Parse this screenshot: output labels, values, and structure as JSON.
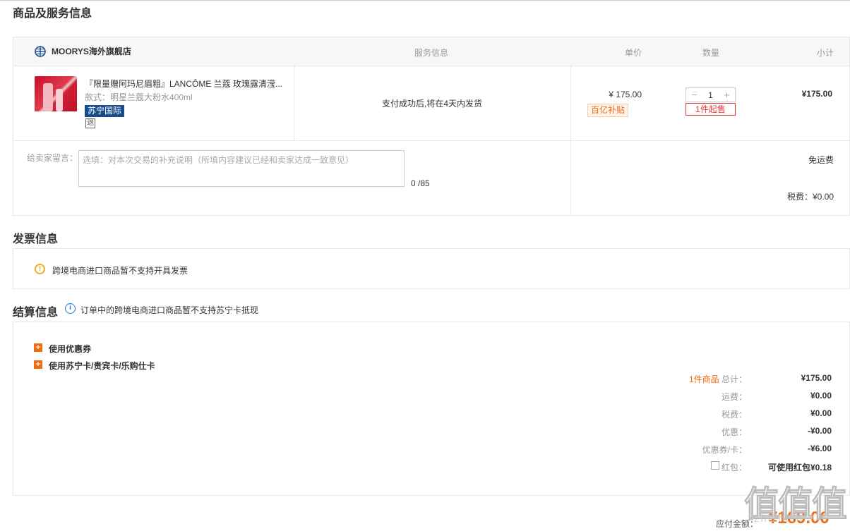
{
  "sections": {
    "goods_title": "商品及服务信息",
    "invoice_title": "发票信息",
    "settle_title": "结算信息"
  },
  "table_header": {
    "store_name": "MOORYS海外旗舰店",
    "service": "服务信息",
    "unit_price": "单价",
    "quantity": "数量",
    "subtotal": "小计"
  },
  "product": {
    "name": "『限量赠阿玛尼眉粗』LANCÔME 兰蔻 玫瑰露清滢...",
    "spec": "款式：明星兰蔻大粉水400ml",
    "badge": "苏宁国际",
    "refund_icon": "退",
    "service_info": "支付成功后,将在4天内发货",
    "price": "¥ 175.00",
    "subsidy": "百亿补贴",
    "qty_minus": "−",
    "qty": "1",
    "qty_plus": "+",
    "min_buy": "1件起售",
    "subtotal": "¥175.00"
  },
  "message": {
    "label": "给卖家留言：",
    "placeholder": "选填：对本次交易的补充说明（所填内容建议已经和卖家达成一致意见）",
    "counter": "0 /85",
    "shipping": "免运费",
    "tax": "税费：¥0.00"
  },
  "invoice": {
    "icon": "warning-icon",
    "text": "跨境电商进口商品暂不支持开具发票"
  },
  "settle": {
    "note": "订单中的跨境电商进口商品暂不支持苏宁卡抵现",
    "options": [
      "使用优惠券",
      "使用苏宁卡/贵宾卡/乐购仕卡"
    ],
    "summary": {
      "count": "1件商品",
      "total_label": " 总计：",
      "total": "¥175.00",
      "shipping_label": "运费：",
      "shipping": "¥0.00",
      "tax_label": "税费：",
      "tax": "¥0.00",
      "discount_label": "优惠：",
      "discount": "-¥0.00",
      "coupon_label": "优惠券/卡：",
      "coupon": "-¥6.00",
      "redpacket_label": "红包：",
      "redpacket": "可使用红包¥0.18"
    },
    "payable_label": "应付金额：",
    "payable": "¥169.00"
  },
  "watermark": {
    "main": "值值值",
    "sub": "zhizhizhi"
  },
  "colors": {
    "accent": "#f06a0f",
    "red": "#e4393c",
    "intl_badge": "#1a4c8b",
    "info_blue": "#1e7ad6",
    "warn": "#f5a623"
  }
}
